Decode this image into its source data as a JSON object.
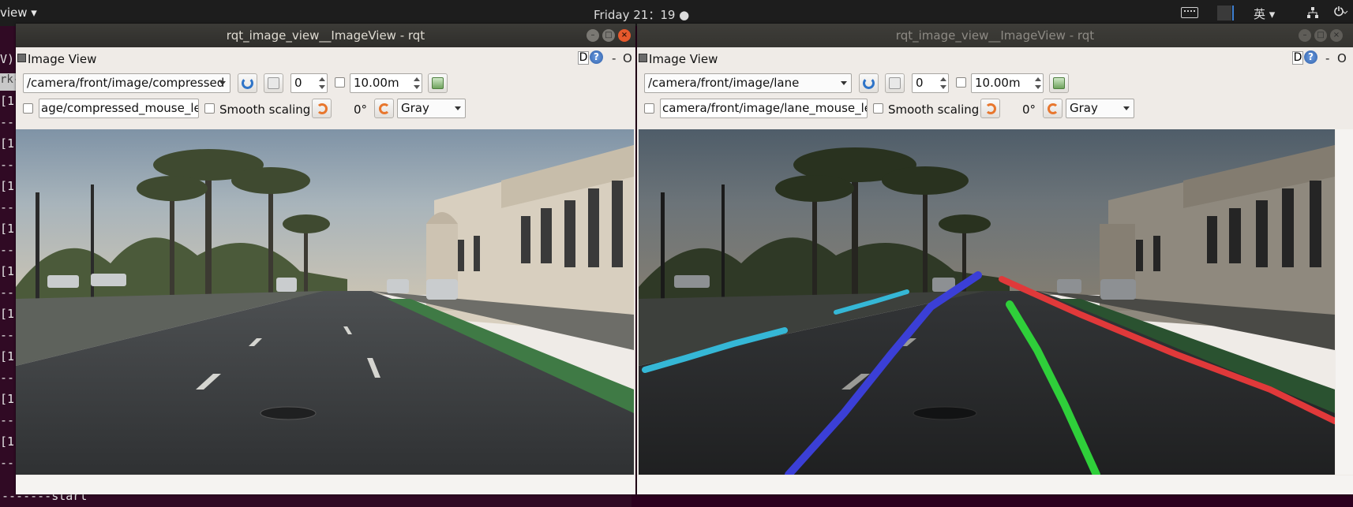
{
  "topbar": {
    "app_menu": "view ▾",
    "clock": "Friday 21：19 ●",
    "ime": "英 ▾",
    "network_icon": "network-icon",
    "power_icon": "power-icon"
  },
  "terminal": {
    "bracket_lines": [
      "[1",
      "[1",
      "[1",
      "[1",
      "[1",
      "[1",
      "[1",
      "[1",
      "[1"
    ],
    "dash_lines": [
      "--",
      "--",
      "--",
      "--",
      "--",
      "--",
      "--",
      "--",
      "--"
    ],
    "gray_text": "rk-",
    "v_text": "V)",
    "bottom_text": "-------start"
  },
  "windows": {
    "left": {
      "title": "rqt_image_view__ImageView - rqt",
      "plugin_name": "Image View",
      "d_label": "D",
      "help_label": "?",
      "dash_label": "-",
      "o_label": "O",
      "topic": "/camera/front/image/compressed",
      "queue_value": "0",
      "timeout_value": "10.00m",
      "mouse_topic": "age/compressed_mouse_left",
      "smooth_label": "Smooth scaling",
      "rotation": "0°",
      "color_scheme": "Gray"
    },
    "right": {
      "title": "rqt_image_view__ImageView - rqt",
      "plugin_name": "Image View",
      "d_label": "D",
      "help_label": "?",
      "dash_label": "-",
      "o_label": "O",
      "topic": "/camera/front/image/lane",
      "queue_value": "0",
      "timeout_value": "10.00m",
      "mouse_topic": "camera/front/image/lane_mouse_left",
      "smooth_label": "Smooth scaling",
      "rotation": "0°",
      "color_scheme": "Gray"
    }
  },
  "lane_colors": {
    "left_outer": "#35b7d6",
    "left_inner": "#3b3fd6",
    "right_inner": "#2fcf3a",
    "right_outer": "#e0393a"
  }
}
